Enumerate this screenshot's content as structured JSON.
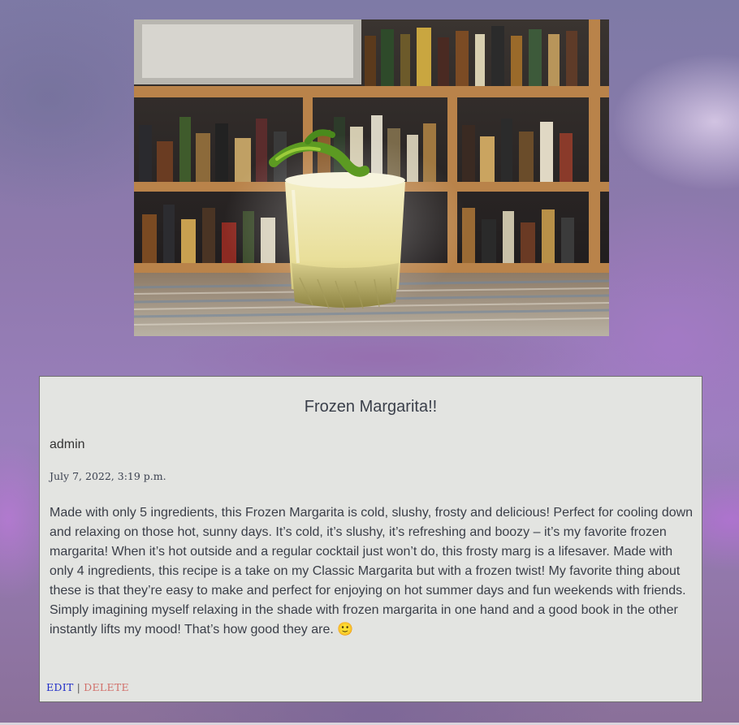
{
  "post": {
    "title": "Frozen Margarita!!",
    "author": "admin",
    "date": "July 7, 2022, 3:19 p.m.",
    "body": "Made with only 5 ingredients, this Frozen Margarita is cold, slushy, frosty and delicious! Perfect for cooling down and relaxing on those hot, sunny days. It’s cold, it’s slushy, it’s refreshing and boozy – it’s my favorite frozen margarita! When it’s hot outside and a regular cocktail just won’t do, this frosty marg is a lifesaver. Made with only 4 ingredients, this recipe is a take on my Classic Margarita but with a frozen twist! My favorite thing about these is that they’re easy to make and perfect for enjoying on hot summer days and fun weekends with friends. Simply imagining myself relaxing in the shade with frozen margarita in one hand and a good book in the other instantly lifts my mood! That’s how good they are. 🙂",
    "image_subject": "frozen-margarita-photo"
  },
  "actions": {
    "edit_label": "EDIT",
    "separator": "|",
    "delete_label": "DELETE"
  },
  "colors": {
    "edit_link": "#1f2cc8",
    "delete_link": "#d1706a",
    "card_background": "#e3e4e1"
  }
}
